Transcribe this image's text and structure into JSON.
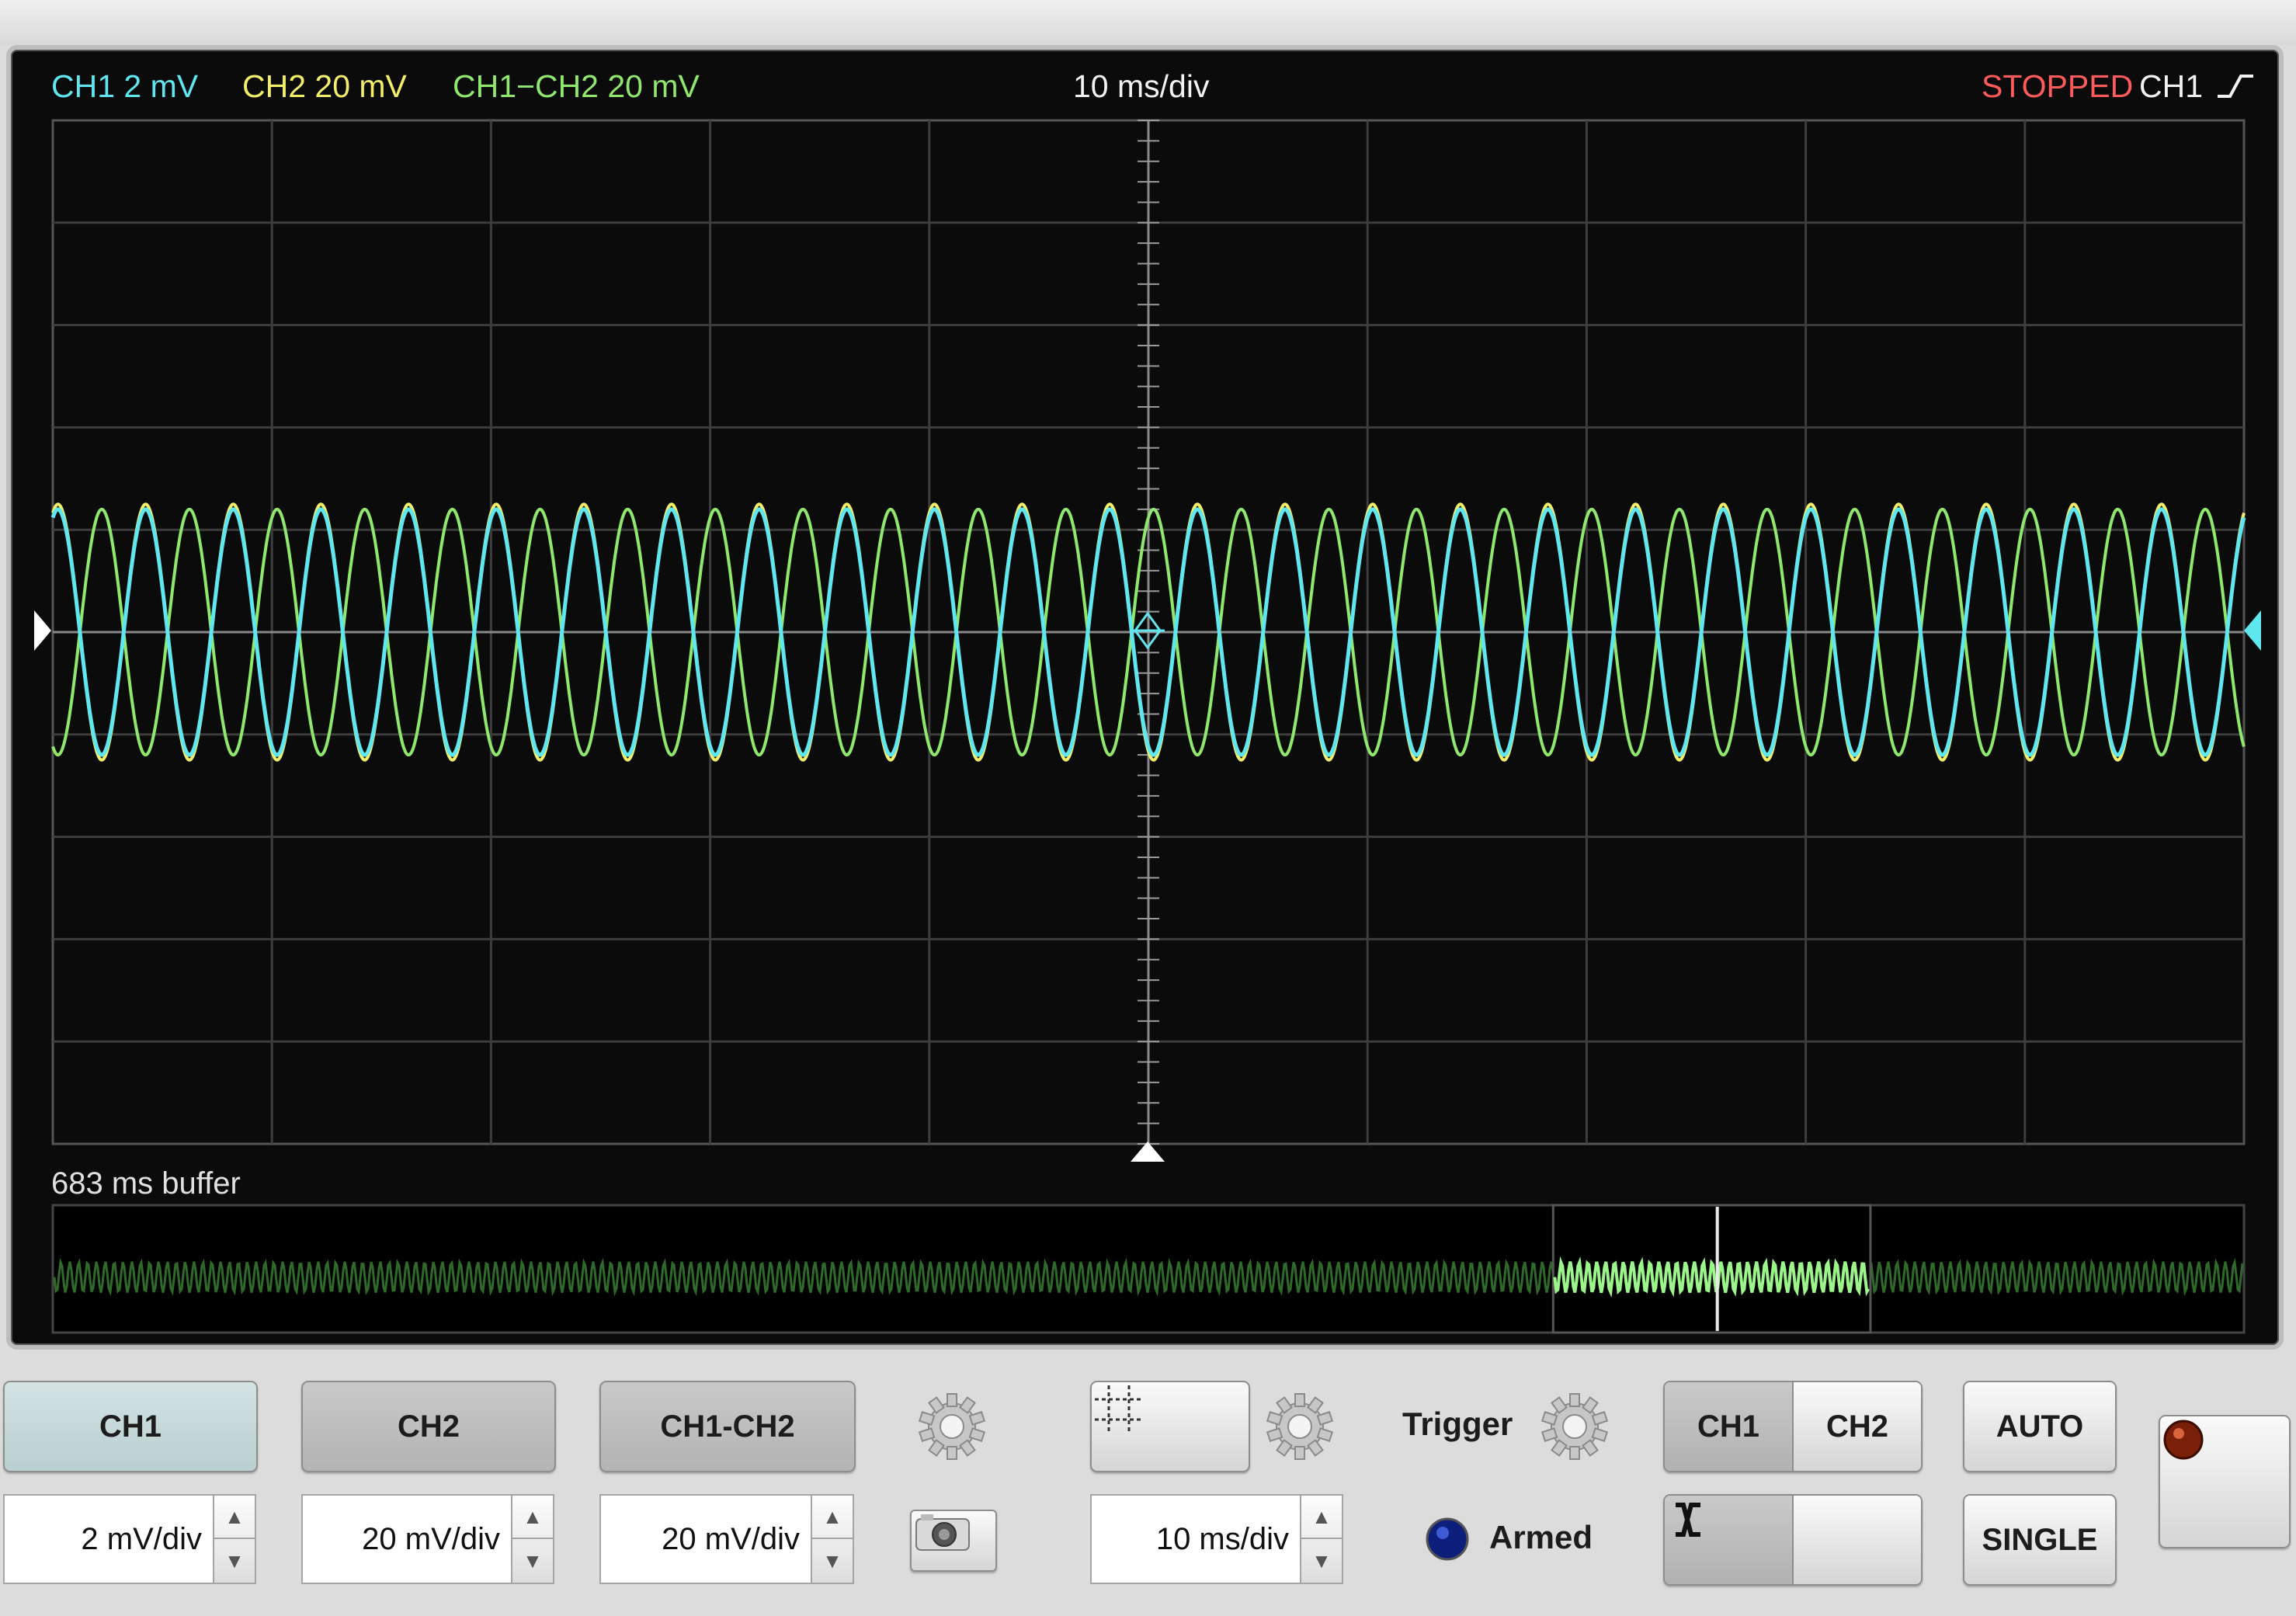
{
  "status_bar": {
    "ch1_scale": "CH1 2 mV",
    "ch2_scale": "CH2 20 mV",
    "diff_scale": "CH1−CH2 20 mV",
    "timebase": "10 ms/div",
    "run_state": "STOPPED",
    "trigger_source": "CH1",
    "trigger_slope_icon": "rising-edge-icon"
  },
  "buffer": {
    "label": "683 ms buffer"
  },
  "colors": {
    "ch1": "#5fe6ef",
    "ch2": "#f3ee6a",
    "diff": "#8fe86d",
    "stopped": "#ff5b5b",
    "screen_bg": "#0b0b0b",
    "grid": "#3d3d3d"
  },
  "chart_data": {
    "type": "line",
    "x_unit": "div",
    "y_unit": "div",
    "xlim": [
      -5,
      5
    ],
    "ylim": [
      -5,
      5
    ],
    "grid": true,
    "series": [
      {
        "name": "CH1",
        "period_div": 0.4,
        "amplitude_div": 1.2,
        "phase": 0.0,
        "color": "#5fe6ef"
      },
      {
        "name": "CH2",
        "period_div": 0.4,
        "amplitude_div": 1.25,
        "phase": 0.0,
        "color": "#f3ee6a"
      },
      {
        "name": "CH1−CH2",
        "period_div": 0.4,
        "amplitude_div": 1.2,
        "phase": 3.14159,
        "color": "#8fe86d"
      }
    ],
    "buffer_view": {
      "window_start": 0.685,
      "window_end": 0.83,
      "cursor": 0.76
    }
  },
  "controls": {
    "channel_buttons": [
      {
        "label": "CH1",
        "scale": "2 mV/div"
      },
      {
        "label": "CH2",
        "scale": "20 mV/div"
      },
      {
        "label": "CH1-CH2",
        "scale": "20 mV/div"
      }
    ],
    "timebase_field": "10 ms/div",
    "trigger_label": "Trigger",
    "armed_label": "Armed",
    "trigger_source_options": [
      "CH1",
      "CH2"
    ],
    "trigger_source_selected": "CH1",
    "slope_options": [
      "rising-edge-icon",
      "falling-edge-icon"
    ],
    "slope_selected": "rising-edge-icon",
    "auto_label": "AUTO",
    "single_label": "SINGLE",
    "icons": [
      "gear-icon",
      "camera-icon",
      "crosshair-icon",
      "record-icon",
      "armed-led-icon"
    ]
  }
}
